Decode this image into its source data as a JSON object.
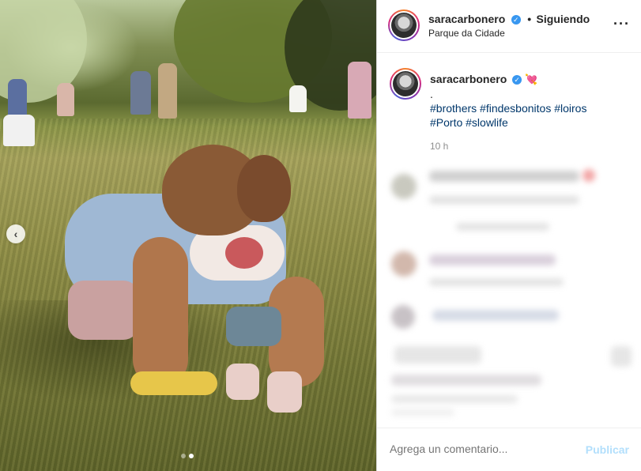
{
  "post": {
    "username": "saracarbonero",
    "follow_status": "Siguiendo",
    "separator": "•",
    "location": "Parque da Cidade",
    "caption_dot": ".",
    "hashtags_line1": "#brothers #findesbonitos #loiros",
    "hashtags_line2": "#Porto #slowlife",
    "time": "10 h",
    "heart_emoji": "💘",
    "verified_glyph": "✓"
  },
  "carousel": {
    "prev_glyph": "‹",
    "dot_count": 2,
    "active_dot": 2
  },
  "comment_box": {
    "placeholder": "Agrega un comentario...",
    "publish_label": "Publicar"
  },
  "menu": {
    "more_glyph": "···"
  },
  "colors": {
    "hashtag": "#00376b",
    "verified": "#3897f0",
    "publish_disabled": "#b2dffc",
    "muted": "#8e8e8e"
  },
  "icons": [
    "verified-badge-icon",
    "more-options-icon",
    "carousel-prev-icon",
    "heart-arrow-emoji"
  ]
}
